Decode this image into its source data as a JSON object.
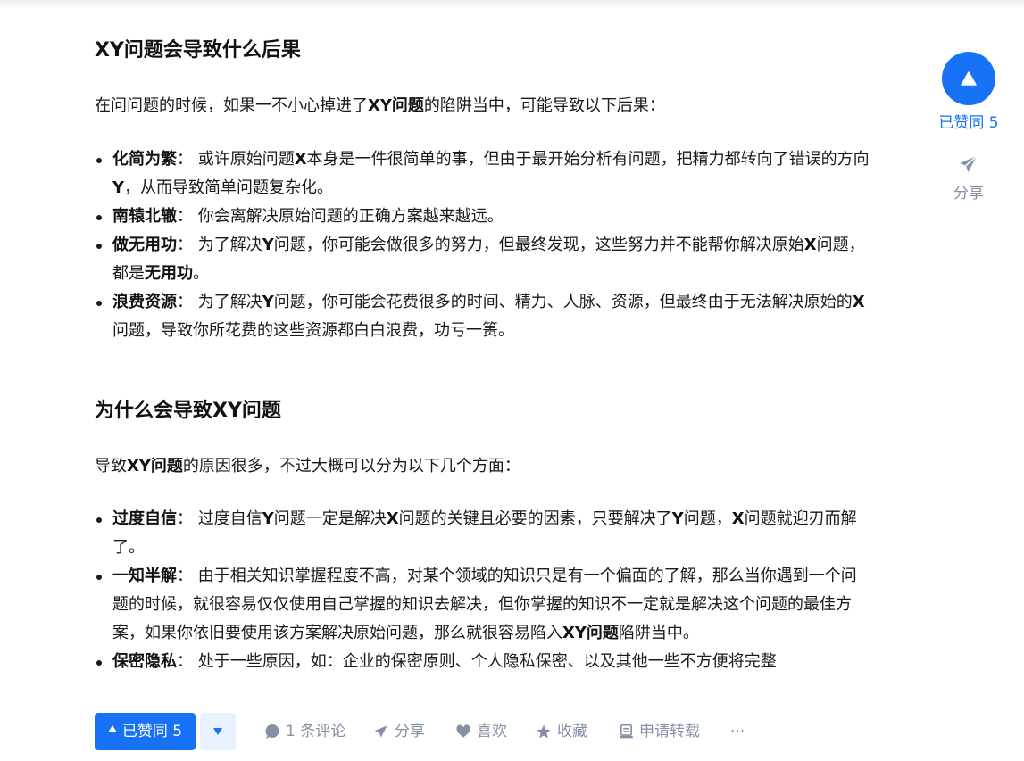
{
  "section1": {
    "heading": "XY问题会导致什么后果",
    "intro": [
      {
        "t": "在问问题的时候，如果一不小心掉进了"
      },
      {
        "t": "XY问题",
        "b": true
      },
      {
        "t": "的陷阱当中，可能导致以下后果："
      }
    ],
    "items": [
      [
        {
          "t": "化简为繁",
          "b": true
        },
        {
          "t": "： 或许原始问题"
        },
        {
          "t": "X",
          "b": true
        },
        {
          "t": "本身是一件很简单的事，但由于最开始分析有问题，把精力都转向了错误的方向"
        },
        {
          "t": "Y",
          "b": true
        },
        {
          "t": "，从而导致简单问题复杂化。"
        }
      ],
      [
        {
          "t": "南辕北辙",
          "b": true
        },
        {
          "t": "： 你会离解决原始问题的正确方案越来越远。"
        }
      ],
      [
        {
          "t": "做无用功",
          "b": true
        },
        {
          "t": "： 为了解决"
        },
        {
          "t": "Y",
          "b": true
        },
        {
          "t": "问题，你可能会做很多的努力，但最终发现，这些努力并不能帮你解决原始"
        },
        {
          "t": "X",
          "b": true
        },
        {
          "t": "问题，都是"
        },
        {
          "t": "无用功",
          "b": true
        },
        {
          "t": "。"
        }
      ],
      [
        {
          "t": "浪费资源",
          "b": true
        },
        {
          "t": "： 为了解决"
        },
        {
          "t": "Y",
          "b": true
        },
        {
          "t": "问题，你可能会花费很多的时间、精力、人脉、资源，但最终由于无法解决原始的"
        },
        {
          "t": "X",
          "b": true
        },
        {
          "t": "问题，导致你所花费的这些资源都白白浪费，功亏一篑。"
        }
      ]
    ]
  },
  "section2": {
    "heading": "为什么会导致XY问题",
    "intro": [
      {
        "t": "导致"
      },
      {
        "t": "XY问题",
        "b": true
      },
      {
        "t": "的原因很多，不过大概可以分为以下几个方面："
      }
    ],
    "items": [
      [
        {
          "t": "过度自信",
          "b": true
        },
        {
          "t": "： 过度自信"
        },
        {
          "t": "Y",
          "b": true
        },
        {
          "t": "问题一定是解决"
        },
        {
          "t": "X",
          "b": true
        },
        {
          "t": "问题的关键且必要的因素，只要解决了"
        },
        {
          "t": "Y",
          "b": true
        },
        {
          "t": "问题，"
        },
        {
          "t": "X",
          "b": true
        },
        {
          "t": "问题就迎刃而解了。"
        }
      ],
      [
        {
          "t": "一知半解",
          "b": true
        },
        {
          "t": "： 由于相关知识掌握程度不高，对某个领域的知识只是有一个偏面的了解，那么当你遇到一个问题的时候，就很容易仅仅使用自己掌握的知识去解决，但你掌握的知识不一定就是解决这个问题的最佳方案，如果你依旧要使用该方案解决原始问题，那么就很容易陷入"
        },
        {
          "t": "XY问题",
          "b": true
        },
        {
          "t": "陷阱当中。"
        }
      ],
      [
        {
          "t": "保密隐私",
          "b": true
        },
        {
          "t": "： 处于一些原因，如：企业的保密原则、个人隐私保密、以及其他一些不方便将完整"
        }
      ]
    ]
  },
  "sidebar": {
    "vote_label": "已赞同 5",
    "share_label": "分享"
  },
  "actions": {
    "vote_label": "已赞同 5",
    "comment_label": "1 条评论",
    "share_label": "分享",
    "like_label": "喜欢",
    "collect_label": "收藏",
    "repost_label": "申请转载",
    "more_label": "···"
  },
  "colors": {
    "accent": "#1772f6",
    "muted": "#8590a6",
    "text": "#1a1a1a"
  }
}
